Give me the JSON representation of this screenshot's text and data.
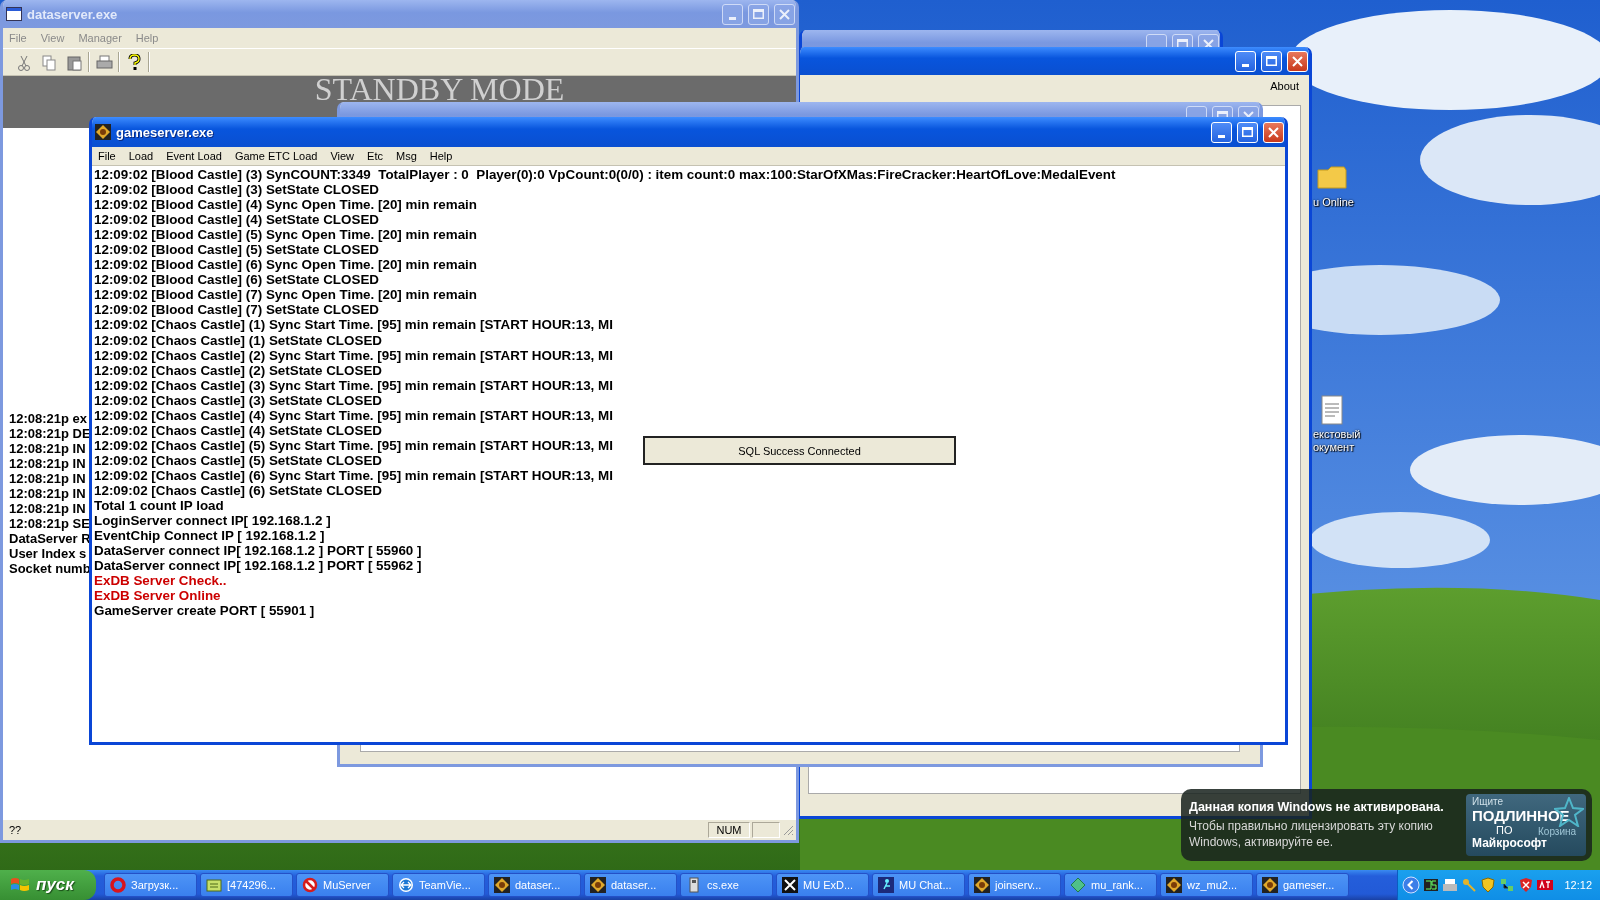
{
  "dataserver_window": {
    "title": "dataserver.exe",
    "active": false,
    "menu": [
      "File",
      "View",
      "Manager",
      "Help"
    ],
    "banner": "STANDBY MODE",
    "log": [
      "12:08:21p ex",
      "12:08:21p DE",
      "12:08:21p IN",
      "12:08:21p IN",
      "12:08:21p IN",
      "12:08:21p IN",
      "12:08:21p IN",
      "12:08:21p SE",
      "DataServer R",
      "User Index s",
      "Socket numb"
    ],
    "status_bar": {
      "text": "??",
      "indicator": "NUM"
    }
  },
  "windows_behind": [
    {
      "active": false
    },
    {
      "active": true,
      "menu": [
        "About"
      ]
    }
  ],
  "event_server_window": {
    "active": false
  },
  "gameserver_window": {
    "title": "gameserver.exe",
    "active": true,
    "menu": [
      "File",
      "Load",
      "Event Load",
      "Game ETC Load",
      "View",
      "Etc",
      "Msg",
      "Help"
    ],
    "log": [
      {
        "text": "12:09:02 [Blood Castle] (3) SynCOUNT:3349  TotalPlayer : 0  Player(0):0 VpCount:0(0/0) : item count:0 max:100:StarOfXMas:FireCracker:HeartOfLove:MedalEvent",
        "color": "#000000"
      },
      {
        "text": "12:09:02 [Blood Castle] (3) SetState CLOSED",
        "color": "#000000"
      },
      {
        "text": "12:09:02 [Blood Castle] (4) Sync Open Time. [20] min remain",
        "color": "#000000"
      },
      {
        "text": "12:09:02 [Blood Castle] (4) SetState CLOSED",
        "color": "#000000"
      },
      {
        "text": "12:09:02 [Blood Castle] (5) Sync Open Time. [20] min remain",
        "color": "#000000"
      },
      {
        "text": "12:09:02 [Blood Castle] (5) SetState CLOSED",
        "color": "#000000"
      },
      {
        "text": "12:09:02 [Blood Castle] (6) Sync Open Time. [20] min remain",
        "color": "#000000"
      },
      {
        "text": "12:09:02 [Blood Castle] (6) SetState CLOSED",
        "color": "#000000"
      },
      {
        "text": "12:09:02 [Blood Castle] (7) Sync Open Time. [20] min remain",
        "color": "#000000"
      },
      {
        "text": "12:09:02 [Blood Castle] (7) SetState CLOSED",
        "color": "#000000"
      },
      {
        "text": "12:09:02 [Chaos Castle] (1) Sync Start Time. [95] min remain [START HOUR:13, MI",
        "color": "#000000"
      },
      {
        "text": "12:09:02 [Chaos Castle] (1) SetState CLOSED",
        "color": "#000000"
      },
      {
        "text": "12:09:02 [Chaos Castle] (2) Sync Start Time. [95] min remain [START HOUR:13, MI",
        "color": "#000000"
      },
      {
        "text": "12:09:02 [Chaos Castle] (2) SetState CLOSED",
        "color": "#000000"
      },
      {
        "text": "12:09:02 [Chaos Castle] (3) Sync Start Time. [95] min remain [START HOUR:13, MI",
        "color": "#000000"
      },
      {
        "text": "12:09:02 [Chaos Castle] (3) SetState CLOSED",
        "color": "#000000"
      },
      {
        "text": "12:09:02 [Chaos Castle] (4) Sync Start Time. [95] min remain [START HOUR:13, MI",
        "color": "#000000"
      },
      {
        "text": "12:09:02 [Chaos Castle] (4) SetState CLOSED",
        "color": "#000000"
      },
      {
        "text": "12:09:02 [Chaos Castle] (5) Sync Start Time. [95] min remain [START HOUR:13, MI",
        "color": "#000000"
      },
      {
        "text": "12:09:02 [Chaos Castle] (5) SetState CLOSED",
        "color": "#000000"
      },
      {
        "text": "12:09:02 [Chaos Castle] (6) Sync Start Time. [95] min remain [START HOUR:13, MI",
        "color": "#000000"
      },
      {
        "text": "12:09:02 [Chaos Castle] (6) SetState CLOSED",
        "color": "#000000"
      },
      {
        "text": "Total 1 count IP load",
        "color": "#000000"
      },
      {
        "text": "LoginServer connect IP[ 192.168.1.2 ]",
        "color": "#000000"
      },
      {
        "text": "EventChip Connect IP [ 192.168.1.2 ]",
        "color": "#000000"
      },
      {
        "text": "DataServer connect IP[ 192.168.1.2 ] PORT [ 55960 ]",
        "color": "#000000"
      },
      {
        "text": "DataServer connect IP[ 192.168.1.2 ] PORT [ 55962 ]",
        "color": "#000000"
      },
      {
        "text": "ExDB Server Check..",
        "color": "#cc0000"
      },
      {
        "text": "ExDB Server Online",
        "color": "#cc0000"
      },
      {
        "text": "GameServer create PORT [ 55901 ]",
        "color": "#000000"
      }
    ]
  },
  "dialog": {
    "message": "SQL Success Connected"
  },
  "desktop_icons": [
    {
      "kind": "folder",
      "label": "u Online"
    },
    {
      "kind": "document",
      "label": "екстовый окумент"
    }
  ],
  "activation_balloon": {
    "title": "Данная копия Windows не активирована.",
    "body": "Чтобы правильно лицензировать эту копию Windows, активируйте ее.",
    "logo": [
      "Ищите",
      "ПОДЛИННОЕ",
      "ПО",
      "Майкрософт"
    ],
    "overlay_label": "Корзина"
  },
  "taskbar": {
    "start": "пуск",
    "items": [
      {
        "kind": "ring",
        "label": "Загрузк..."
      },
      {
        "kind": "notes",
        "label": "[474296..."
      },
      {
        "kind": "stop",
        "label": "MuServer"
      },
      {
        "kind": "arrows",
        "label": "TeamVie..."
      },
      {
        "kind": "emblem",
        "label": "dataser..."
      },
      {
        "kind": "emblem",
        "label": "dataser..."
      },
      {
        "kind": "file",
        "label": "cs.exe"
      },
      {
        "kind": "dark",
        "label": "MU ExD..."
      },
      {
        "kind": "chat",
        "label": "MU Chat..."
      },
      {
        "kind": "emblem",
        "label": "joinserv..."
      },
      {
        "kind": "gem",
        "label": "mu_rank..."
      },
      {
        "kind": "emblem",
        "label": "wz_mu2..."
      },
      {
        "kind": "emblem",
        "label": "gameser..."
      }
    ],
    "clock": "12:12"
  }
}
